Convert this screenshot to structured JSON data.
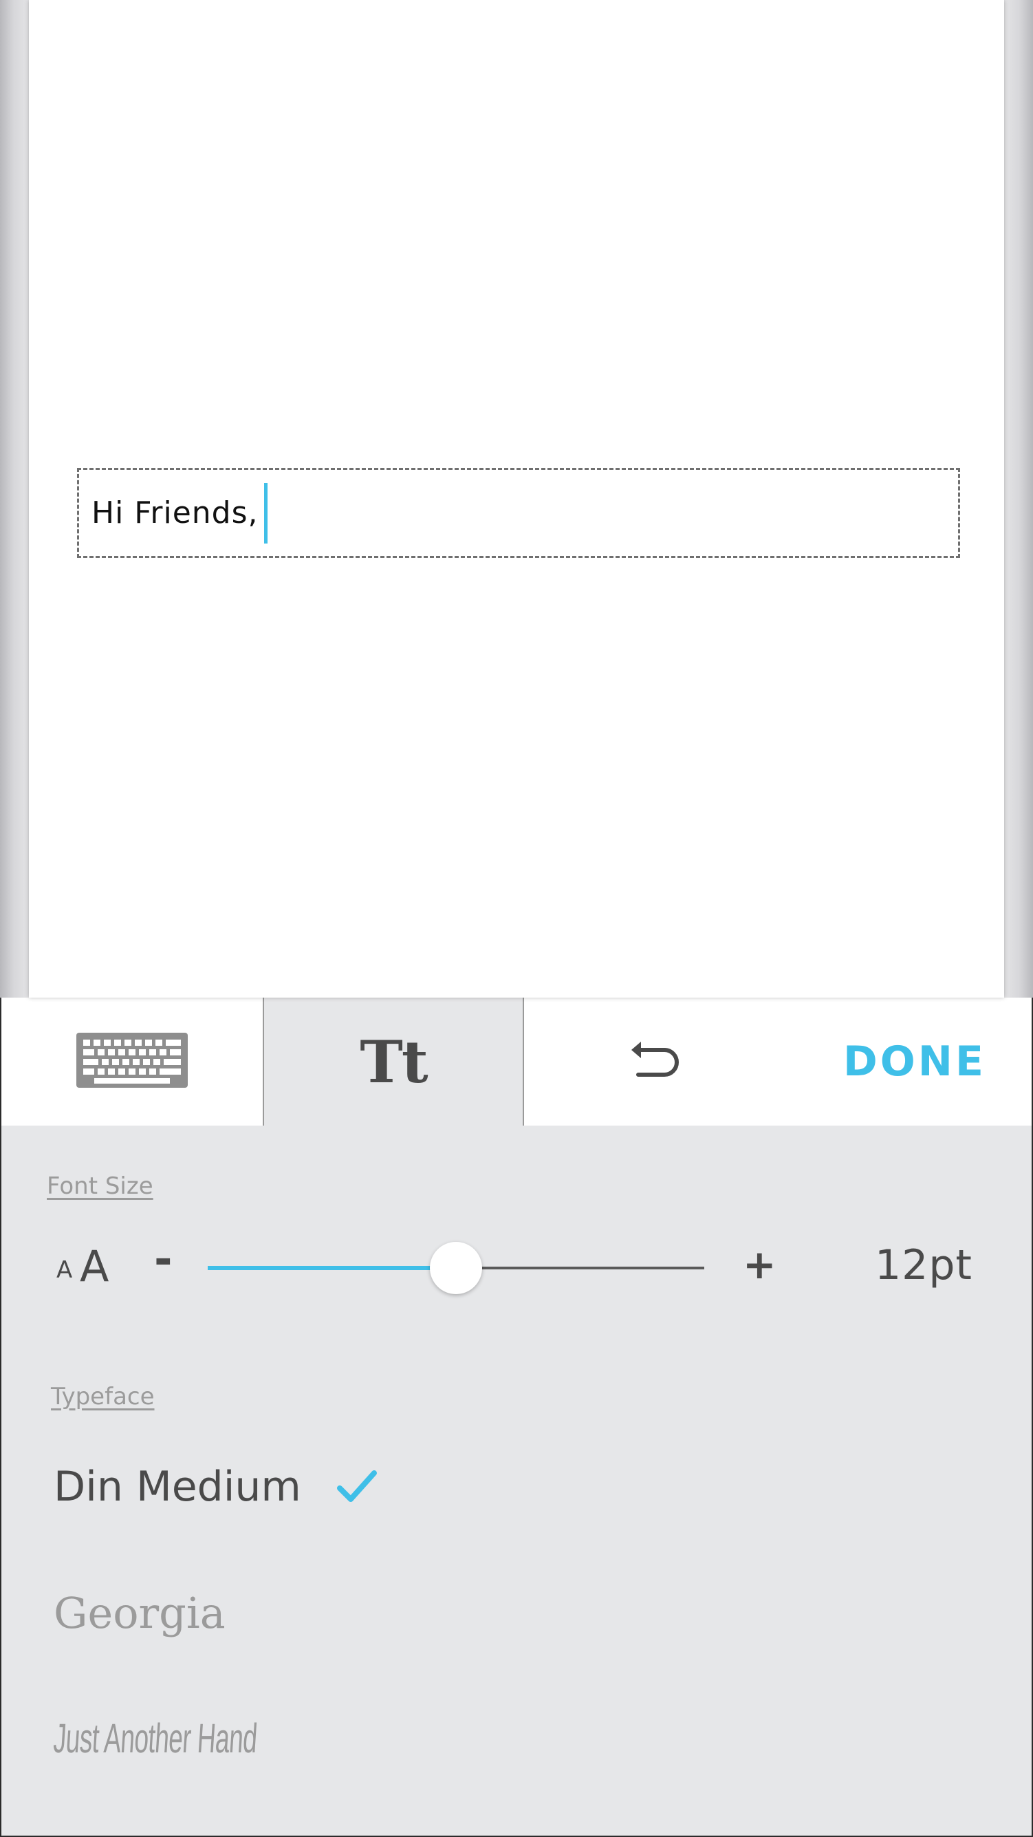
{
  "editor": {
    "text_value": "Hi Friends,"
  },
  "toolbar": {
    "keyboard_icon": "keyboard-icon",
    "text_style_label": "Tt",
    "undo_icon": "undo-icon",
    "done_label": "DONE"
  },
  "font_size": {
    "section_label": "Font Size",
    "small_a": "A",
    "large_a": "A",
    "decrease_label": "-",
    "increase_label": "+",
    "value_label": "12pt",
    "slider_fraction": 0.5
  },
  "typeface": {
    "section_label": "Typeface",
    "options": [
      {
        "name": "Din Medium",
        "selected": true
      },
      {
        "name": "Georgia",
        "selected": false
      },
      {
        "name": "Just Another Hand",
        "selected": false
      }
    ]
  },
  "colors": {
    "accent": "#3fbfe8",
    "panel_bg": "#e6e7e9",
    "text_dark": "#4a4a4a",
    "text_muted": "#9b9b9b"
  }
}
